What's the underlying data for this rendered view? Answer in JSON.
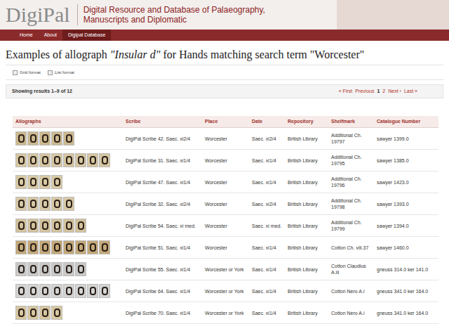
{
  "header": {
    "logo": "DigiPal",
    "tagline_lines": [
      "Digital Resource and Database of Palaeography,",
      "Manuscripts and Diplomatic"
    ]
  },
  "nav": [
    {
      "label": "Home",
      "selected": false
    },
    {
      "label": "About",
      "selected": false
    },
    {
      "label": "Digipal Database",
      "selected": true
    }
  ],
  "title": {
    "prefix": "Examples of allograph ",
    "allograph": "\"Insular d\"",
    "middle": " for Hands matching search term ",
    "term": "\"Worcester\""
  },
  "formats": [
    "Grid format",
    "List format"
  ],
  "results": {
    "summary": "Showing results 1–9 of 12",
    "pages": [
      {
        "label": "« First",
        "selected": false
      },
      {
        "label": "Previous",
        "selected": false
      },
      {
        "label": "1",
        "selected": true
      },
      {
        "label": "2",
        "selected": false
      },
      {
        "label": "Next ›",
        "selected": false
      },
      {
        "label": "Last »",
        "selected": false
      }
    ]
  },
  "table": {
    "columns": [
      "Allographs",
      "Scribe",
      "Place",
      "Date",
      "Repository",
      "Shelfmark",
      "Catalogue Number"
    ],
    "rows": [
      {
        "samples": 5,
        "color": "#cdb98f",
        "scribe": "DigiPal Scribe 42. Saec. xi2/4",
        "place": "Worcester",
        "date": "Saec. xi2/4",
        "repository": "British Library",
        "shelfmark": "Additional Ch. 19797",
        "catalogue": "sawyer 1399.0"
      },
      {
        "samples": 8,
        "color": "#d6c6a2",
        "scribe": "DigiPal Scribe 31. Saec. xi1/4",
        "place": "Worcester",
        "date": "Saec. xi1/4",
        "repository": "British Library",
        "shelfmark": "Additional Ch. 19795",
        "catalogue": "sawyer 1385.0"
      },
      {
        "samples": 4,
        "color": "#d9c9a4",
        "scribe": "DigiPal Scribe 47. Saec. xi1/4",
        "place": "Worcester",
        "date": "Saec. xi1/4",
        "repository": "British Library",
        "shelfmark": "Additional Ch. 19796",
        "catalogue": "sawyer 1423.0"
      },
      {
        "samples": 5,
        "color": "#d8c9a6",
        "scribe": "DigiPal Scribe 32. Saec. xi2/4",
        "place": "Worcester",
        "date": "Saec. xi2/4",
        "repository": "British Library",
        "shelfmark": "Additional Ch. 19798",
        "catalogue": "sawyer 1393.0"
      },
      {
        "samples": 6,
        "color": "#d3c29c",
        "scribe": "DigiPal Scribe 54. Saec. xi med.",
        "place": "Worcester",
        "date": "Saec. xi med.",
        "repository": "British Library",
        "shelfmark": "Additional Ch. 19799",
        "catalogue": "sawyer 1394.0"
      },
      {
        "samples": 8,
        "color": "#c4a878",
        "scribe": "DigiPal Scribe 51. Saec. xi1/4",
        "place": "Worcester",
        "date": "Saec. xi1/4",
        "repository": "British Library",
        "shelfmark": "Cotton Ch. viii.37",
        "catalogue": "sawyer 1460.0"
      },
      {
        "samples": 6,
        "color": "#c9c9c9",
        "scribe": "DigiPal Scribe 55. Saec. xi1/4",
        "place": "Worcester or York",
        "date": "Saec. xi1/4",
        "repository": "British Library",
        "shelfmark": "Cotton Claudius A.iii",
        "catalogue": "gneuss 314.0 ker 141.0"
      },
      {
        "samples": 8,
        "color": "#d4d4d4",
        "scribe": "DigiPal Scribe 64. Saec. xi1/4",
        "place": "Worcester or York",
        "date": "Saec. xi1/4",
        "repository": "British Library",
        "shelfmark": "Cotton Nero A.i",
        "catalogue": "gneuss 341.0 ker 164.0"
      },
      {
        "samples": 4,
        "color": "#d8c7a0",
        "scribe": "DigiPal Scribe 70. Saec. xi1/4",
        "place": "Worcester or York",
        "date": "Saec. xi1/4",
        "repository": "British Library",
        "shelfmark": "Cotton Nero A.i",
        "catalogue": "gneuss 341.0 ker 164.0"
      }
    ]
  }
}
